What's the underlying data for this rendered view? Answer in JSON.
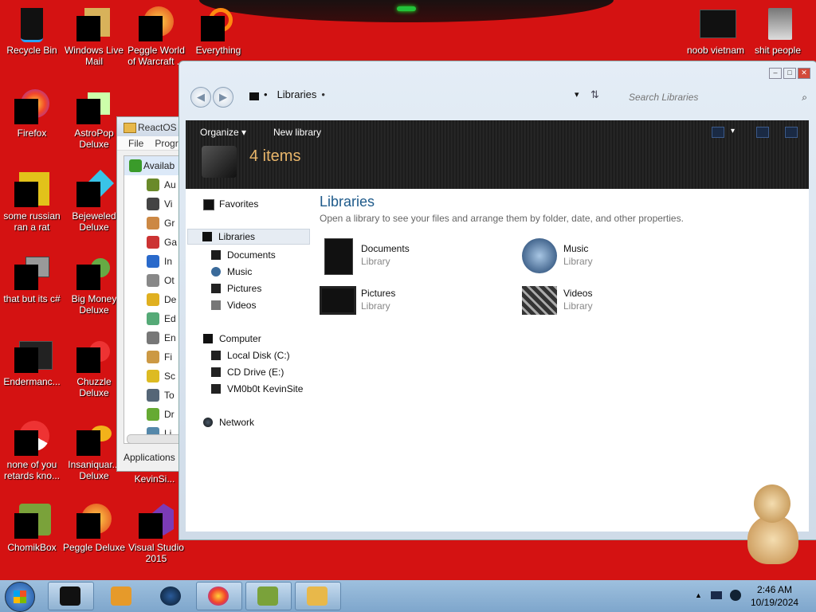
{
  "desktop": {
    "icons_left": [
      {
        "label": "Recycle Bin"
      },
      {
        "label": "Windows Live Mail"
      },
      {
        "label": "Peggle World of Warcraft ..."
      },
      {
        "label": "Everything"
      },
      {
        "label": "Firefox"
      },
      {
        "label": "AstroPop Deluxe"
      },
      {
        "label": "some russian ran a rat"
      },
      {
        "label": "Bejeweled Deluxe"
      },
      {
        "label": "that but its c#"
      },
      {
        "label": "Big Money Deluxe"
      },
      {
        "label": "Endermanc..."
      },
      {
        "label": "Chuzzle Deluxe"
      },
      {
        "label": "none of you retards kno..."
      },
      {
        "label": "Insaniquar... Deluxe"
      },
      {
        "label": "ChomikBox"
      },
      {
        "label": "Peggle Deluxe"
      },
      {
        "label": "Visual Studio 2015"
      }
    ],
    "icons_right": [
      {
        "label": "noob vietnam"
      },
      {
        "label": "shit people"
      }
    ],
    "partial_label": "KevinSi..."
  },
  "reactos_window": {
    "title": "ReactOS ...",
    "menu": [
      "File",
      "Progra"
    ],
    "tree": [
      {
        "label": "Availab",
        "color": "#3a9b2a"
      },
      {
        "label": "Au",
        "color": "#6a8a2a"
      },
      {
        "label": "Vi",
        "color": "#444"
      },
      {
        "label": "Gr",
        "color": "#c84"
      },
      {
        "label": "Ga",
        "color": "#c33"
      },
      {
        "label": "In",
        "color": "#2a6acb"
      },
      {
        "label": "Ot",
        "color": "#888"
      },
      {
        "label": "De",
        "color": "#e0b020"
      },
      {
        "label": "Ed",
        "color": "#5a7"
      },
      {
        "label": "En",
        "color": "#777"
      },
      {
        "label": "Fi",
        "color": "#c94"
      },
      {
        "label": "Sc",
        "color": "#db2"
      },
      {
        "label": "To",
        "color": "#567"
      },
      {
        "label": "Dr",
        "color": "#6a3"
      },
      {
        "label": "Li",
        "color": "#58a"
      }
    ],
    "status": "Applications"
  },
  "explorer": {
    "address": "Libraries",
    "search_placeholder": "Search Libraries",
    "toolbar": {
      "organize": "Organize",
      "organize_arrow": "▾",
      "new_library": "New library"
    },
    "item_count": "4 items",
    "nav": {
      "favorites": "Favorites",
      "libraries": "Libraries",
      "library_items": [
        "Documents",
        "Music",
        "Pictures",
        "Videos"
      ],
      "computer": "Computer",
      "drives": [
        "Local Disk (C:)",
        "CD Drive (E:)",
        "VM0b0t KevinSite"
      ],
      "network": "Network"
    },
    "main": {
      "heading": "Libraries",
      "subtitle": "Open a library to see your files and arrange them by folder, date, and other properties.",
      "libraries": [
        {
          "name": "Documents",
          "type": "Library",
          "icon": "documents-icon"
        },
        {
          "name": "Music",
          "type": "Library",
          "icon": "music-icon"
        },
        {
          "name": "Pictures",
          "type": "Library",
          "icon": "pictures-icon"
        },
        {
          "name": "Videos",
          "type": "Library",
          "icon": "videos-icon"
        }
      ]
    }
  },
  "taskbar": {
    "time": "2:46 AM",
    "date": "10/19/2024"
  }
}
